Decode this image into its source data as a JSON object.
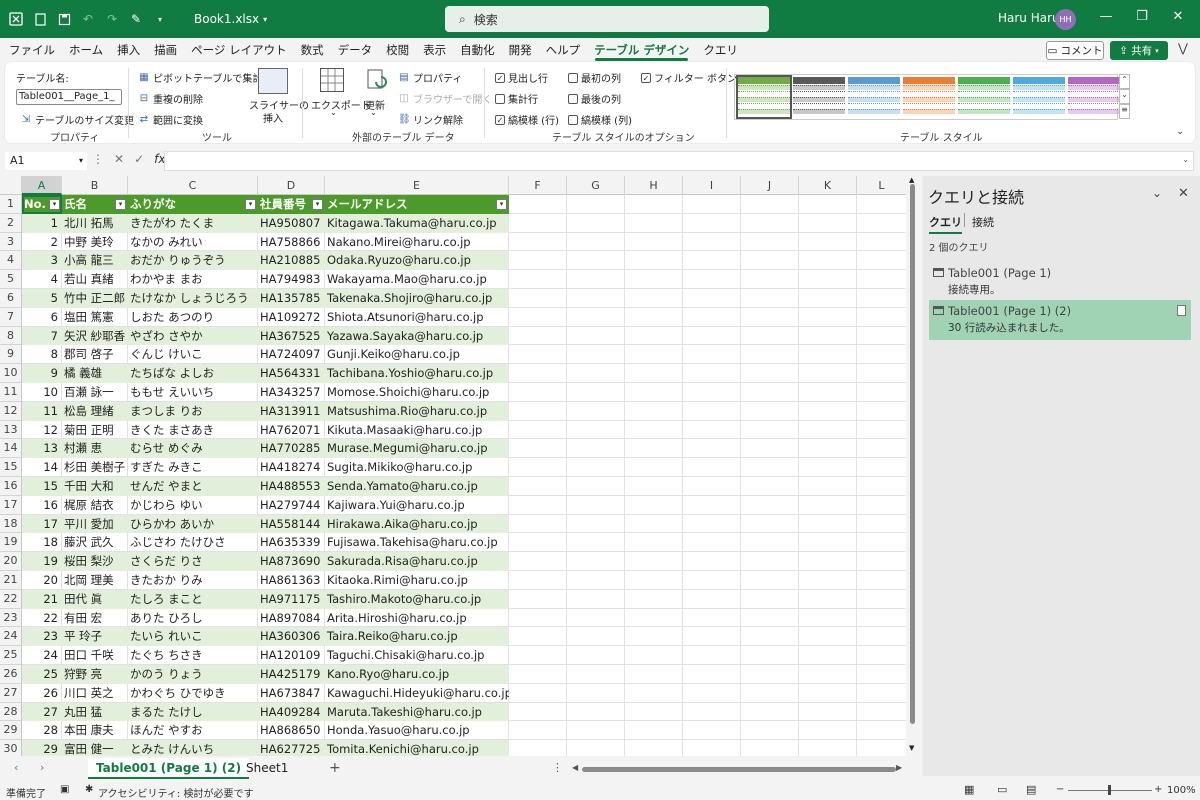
{
  "title_bar": {
    "filename": "Book1.xlsx",
    "search_placeholder": "検索",
    "user_name": "Haru Haru",
    "avatar_initials": "HH",
    "accent": "#107c41"
  },
  "menu": {
    "tabs": [
      "ファイル",
      "ホーム",
      "挿入",
      "描画",
      "ページ レイアウト",
      "数式",
      "データ",
      "校閲",
      "表示",
      "自動化",
      "開発",
      "ヘルプ",
      "テーブル デザイン",
      "クエリ"
    ],
    "active_tab": "テーブル デザイン",
    "comment_label": "コメント",
    "share_label": "共有"
  },
  "ribbon": {
    "properties": {
      "table_name_label": "テーブル名:",
      "table_name_value": "Table001__Page_1_",
      "resize_label": "テーブルのサイズ変更",
      "group_label": "プロパティ"
    },
    "tools": {
      "pivot": "ピボットテーブルで集計",
      "remove_dup": "重複の削除",
      "convert_range": "範囲に変換",
      "slicer": "スライサーの",
      "slicer2": "挿入",
      "group_label": "ツール"
    },
    "external": {
      "export": "エクスポート",
      "refresh": "更新",
      "properties": "プロパティ",
      "open_browser": "ブラウザーで開く",
      "unlink": "リンク解除",
      "group_label": "外部のテーブル データ"
    },
    "options": {
      "header_row": "見出し行",
      "total_row": "集計行",
      "banded_rows": "縞模様 (行)",
      "first_col": "最初の列",
      "last_col": "最後の列",
      "banded_cols": "縞模様 (列)",
      "filter_btn": "フィルター ボタン",
      "group_label": "テーブル スタイルのオプション"
    },
    "styles": {
      "group_label": "テーブル スタイル",
      "swatch_colors": [
        "#70ad47",
        "#595959",
        "#5b9bd5",
        "#ed7d31",
        "#4caf50",
        "#4fa8e0",
        "#b565c4"
      ]
    }
  },
  "formula_bar": {
    "name_box": "A1",
    "fx": "fx",
    "value": ""
  },
  "sheet": {
    "columns": [
      "A",
      "B",
      "C",
      "D",
      "E",
      "F",
      "G",
      "H",
      "I",
      "J",
      "K",
      "L"
    ],
    "headers": [
      "No.",
      "氏名",
      "ふりがな",
      "社員番号",
      "メールアドレス"
    ],
    "rows": [
      [
        "1",
        "北川 拓馬",
        "きたがわ たくま",
        "HA950807",
        "Kitagawa.Takuma@haru.co.jp"
      ],
      [
        "2",
        "中野 美玲",
        "なかの みれい",
        "HA758866",
        "Nakano.Mirei@haru.co.jp"
      ],
      [
        "3",
        "小高 龍三",
        "おだか りゅうぞう",
        "HA210885",
        "Odaka.Ryuzo@haru.co.jp"
      ],
      [
        "4",
        "若山 真緒",
        "わかやま まお",
        "HA794983",
        "Wakayama.Mao@haru.co.jp"
      ],
      [
        "5",
        "竹中 正二郎",
        "たけなか しょうじろう",
        "HA135785",
        "Takenaka.Shojiro@haru.co.jp"
      ],
      [
        "6",
        "塩田 篤憲",
        "しおた あつのり",
        "HA109272",
        "Shiota.Atsunori@haru.co.jp"
      ],
      [
        "7",
        "矢沢 紗耶香",
        "やざわ さやか",
        "HA367525",
        "Yazawa.Sayaka@haru.co.jp"
      ],
      [
        "8",
        "郡司 啓子",
        "ぐんじ けいこ",
        "HA724097",
        "Gunji.Keiko@haru.co.jp"
      ],
      [
        "9",
        "橘 義雄",
        "たちばな よしお",
        "HA564331",
        "Tachibana.Yoshio@haru.co.jp"
      ],
      [
        "10",
        "百瀬 詠一",
        "ももせ えいいち",
        "HA343257",
        "Momose.Shoichi@haru.co.jp"
      ],
      [
        "11",
        "松島 理緒",
        "まつしま りお",
        "HA313911",
        "Matsushima.Rio@haru.co.jp"
      ],
      [
        "12",
        "菊田 正明",
        "きくた まさあき",
        "HA762071",
        "Kikuta.Masaaki@haru.co.jp"
      ],
      [
        "13",
        "村瀬 恵",
        "むらせ めぐみ",
        "HA770285",
        "Murase.Megumi@haru.co.jp"
      ],
      [
        "14",
        "杉田 美樹子",
        "すぎた みきこ",
        "HA418274",
        "Sugita.Mikiko@haru.co.jp"
      ],
      [
        "15",
        "千田 大和",
        "せんだ やまと",
        "HA488553",
        "Senda.Yamato@haru.co.jp"
      ],
      [
        "16",
        "梶原 結衣",
        "かじわら ゆい",
        "HA279744",
        "Kajiwara.Yui@haru.co.jp"
      ],
      [
        "17",
        "平川 愛加",
        "ひらかわ あいか",
        "HA558144",
        "Hirakawa.Aika@haru.co.jp"
      ],
      [
        "18",
        "藤沢 武久",
        "ふじさわ たけひさ",
        "HA635339",
        "Fujisawa.Takehisa@haru.co.jp"
      ],
      [
        "19",
        "桜田 梨沙",
        "さくらだ りさ",
        "HA873690",
        "Sakurada.Risa@haru.co.jp"
      ],
      [
        "20",
        "北岡 理美",
        "きたおか りみ",
        "HA861363",
        "Kitaoka.Rimi@haru.co.jp"
      ],
      [
        "21",
        "田代 眞",
        "たしろ まこと",
        "HA971175",
        "Tashiro.Makoto@haru.co.jp"
      ],
      [
        "22",
        "有田 宏",
        "ありた ひろし",
        "HA897084",
        "Arita.Hiroshi@haru.co.jp"
      ],
      [
        "23",
        "平 玲子",
        "たいら れいこ",
        "HA360306",
        "Taira.Reiko@haru.co.jp"
      ],
      [
        "24",
        "田口 千咲",
        "たぐち ちさき",
        "HA120109",
        "Taguchi.Chisaki@haru.co.jp"
      ],
      [
        "25",
        "狩野 亮",
        "かのう りょう",
        "HA425179",
        "Kano.Ryo@haru.co.jp"
      ],
      [
        "26",
        "川口 英之",
        "かわぐち ひでゆき",
        "HA673847",
        "Kawaguchi.Hideyuki@haru.co.jp"
      ],
      [
        "27",
        "丸田 猛",
        "まるた たけし",
        "HA409284",
        "Maruta.Takeshi@haru.co.jp"
      ],
      [
        "28",
        "本田 康夫",
        "ほんだ やすお",
        "HA868650",
        "Honda.Yasuo@haru.co.jp"
      ],
      [
        "29",
        "富田 健一",
        "とみた けんいち",
        "HA627725",
        "Tomita.Kenichi@haru.co.jp"
      ]
    ],
    "row_numbers": [
      "1",
      "2",
      "3",
      "4",
      "5",
      "6",
      "7",
      "8",
      "9",
      "10",
      "11",
      "12",
      "13",
      "14",
      "15",
      "16",
      "17",
      "18",
      "19",
      "20",
      "21",
      "22",
      "23",
      "24",
      "25",
      "26",
      "27",
      "28",
      "29",
      "30"
    ],
    "header_color": "#4c9a2a",
    "band_color": "#e2efda"
  },
  "sheet_tabs": {
    "tabs": [
      "Table001 (Page 1) (2)",
      "Sheet1"
    ],
    "active": "Table001 (Page 1) (2)"
  },
  "query_pane": {
    "title": "クエリと接続",
    "tab_queries": "クエリ",
    "tab_connections": "接続",
    "count_text": "2 個のクエリ",
    "items": [
      {
        "name": "Table001 (Page 1)",
        "status": "接続専用。"
      },
      {
        "name": "Table001 (Page 1) (2)",
        "status": "30 行読み込まれました。"
      }
    ]
  },
  "status_bar": {
    "ready": "準備完了",
    "accessibility": "アクセシビリティ: 検討が必要です",
    "zoom": "100%"
  }
}
